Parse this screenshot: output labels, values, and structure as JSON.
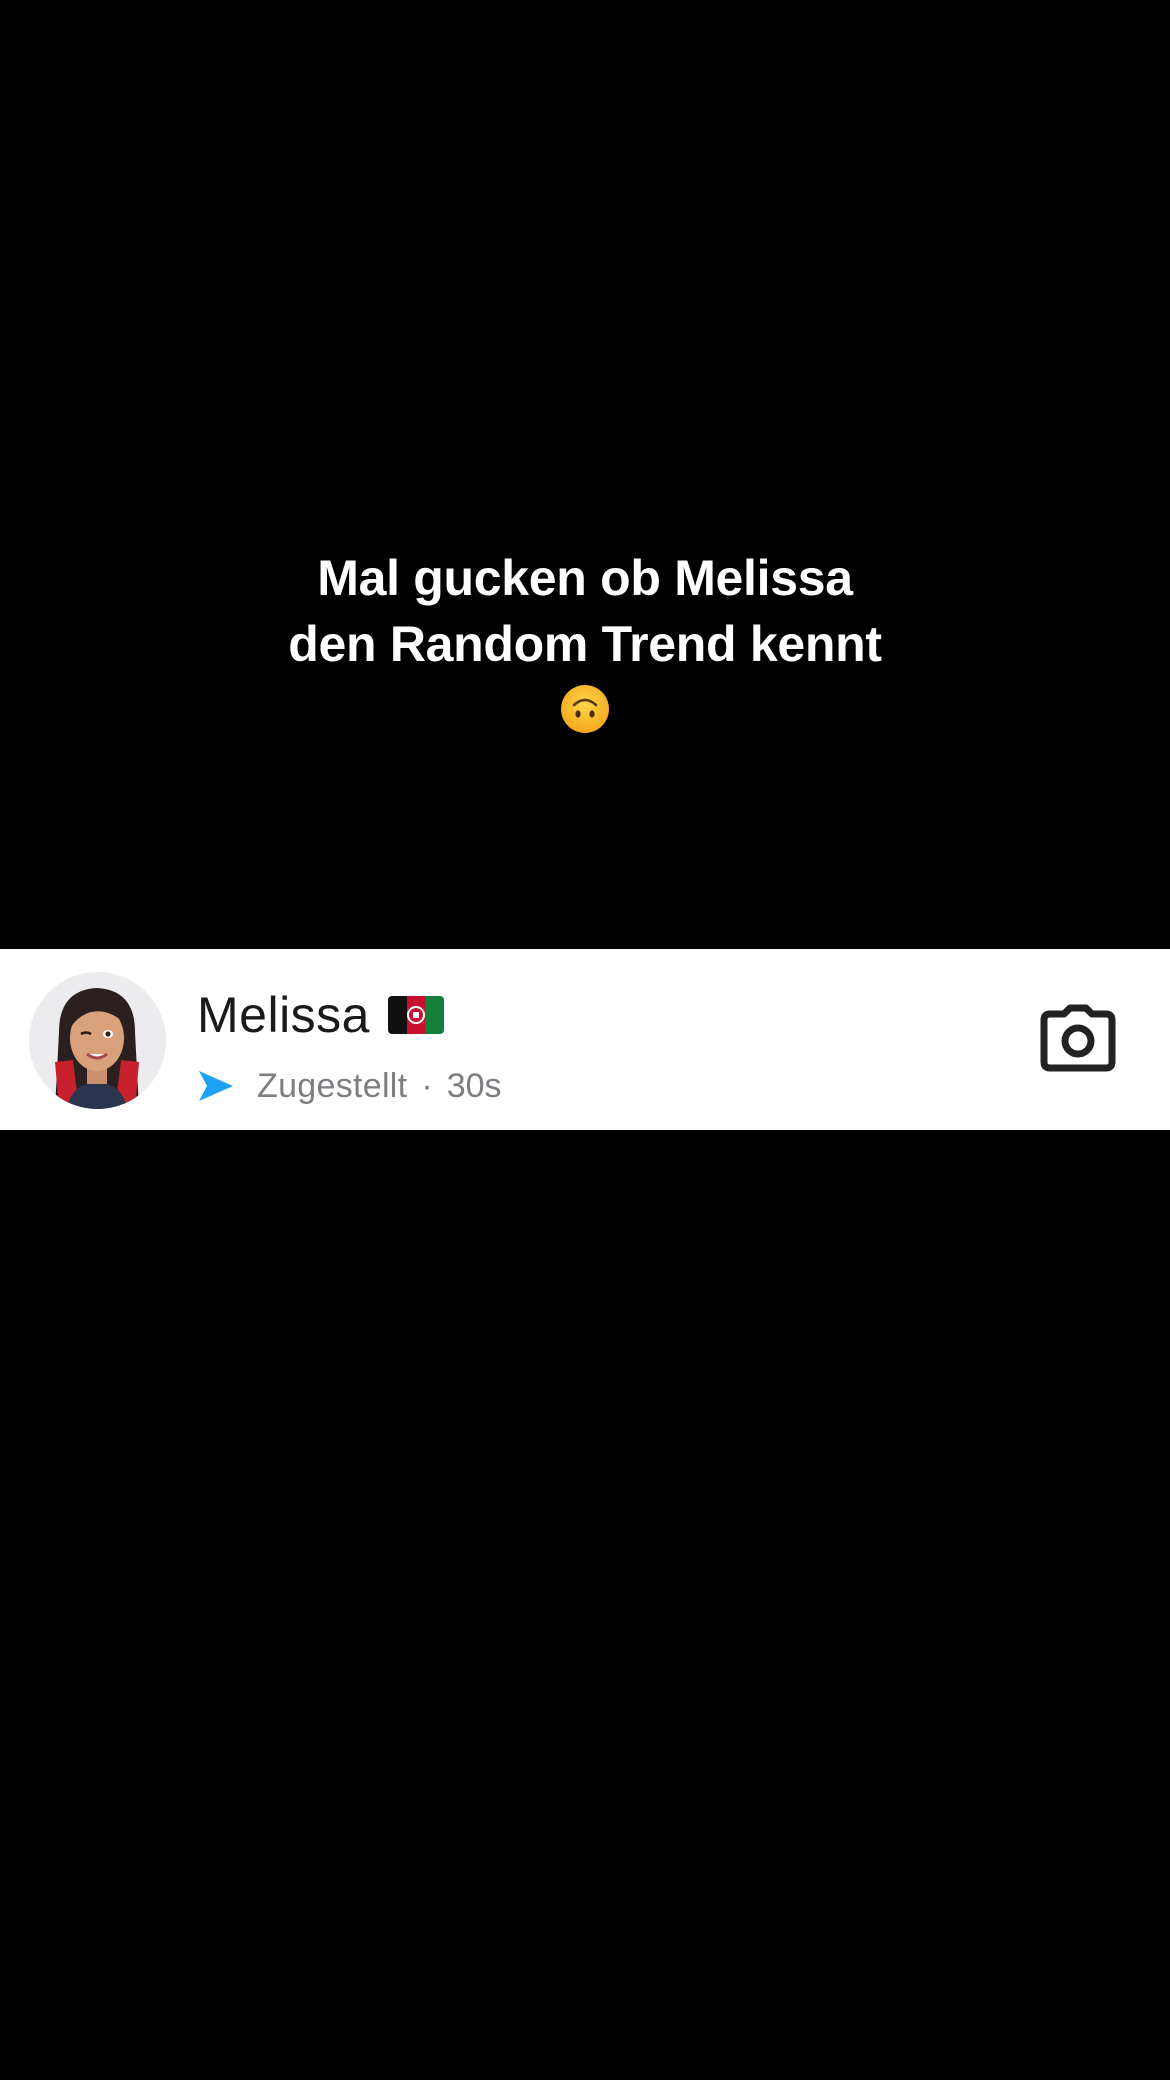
{
  "caption": {
    "line1": "Mal gucken ob Melissa",
    "line2": "den Random Trend kennt",
    "emoji": "upside-down-face-emoji"
  },
  "chat": {
    "name": "Melissa",
    "flag": "afghanistan-flag-icon",
    "status": "Zugestellt",
    "separator": "·",
    "time": "30s",
    "status_icon": "sent-arrow-icon",
    "action_icon": "camera-icon",
    "status_color": "#1DA1F2"
  },
  "colors": {
    "background": "#000000",
    "row_background": "#ffffff",
    "name_text": "#1a1a1a",
    "meta_text": "#7d7e82"
  }
}
